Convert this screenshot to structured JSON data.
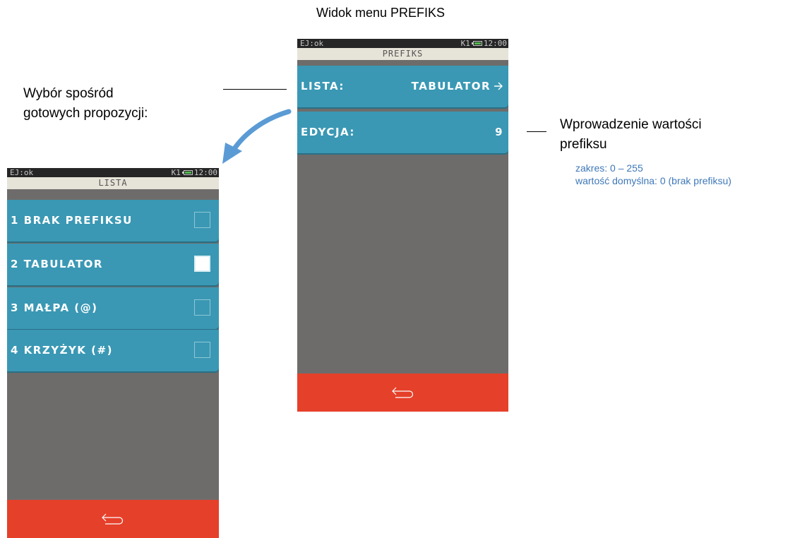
{
  "captions": {
    "title": "Widok menu PREFIKS",
    "left_line1": "Wybór spośród",
    "left_line2": "gotowych propozycji:",
    "right_line1": "Wprowadzenie wartości",
    "right_line2": "prefiksu",
    "right_sub1": "zakres: 0 – 255",
    "right_sub2": "wartość domyślna: 0 (brak prefiksu)"
  },
  "prefiks_screen": {
    "status_left": "EJ:ok",
    "status_k": "K1",
    "status_time": "12:00",
    "title": "PREFIKS",
    "items": [
      {
        "label": "LISTA:",
        "value": "TABULATOR",
        "icon": "arrow-right-icon"
      },
      {
        "label": "EDYCJA:",
        "value": "9"
      }
    ],
    "back_icon": "return-arrow-icon"
  },
  "lista_screen": {
    "status_left": "EJ:ok",
    "status_k": "K1",
    "status_time": "12:00",
    "title": "LISTA",
    "items": [
      {
        "label": "1 BRAK PREFIKSU",
        "checked": false
      },
      {
        "label": "2 TABULATOR",
        "checked": true
      },
      {
        "label": "3 MAŁPA  (@)",
        "checked": false
      },
      {
        "label": "4 KRZYŻYK  (#)",
        "checked": false
      }
    ],
    "back_icon": "return-arrow-icon"
  },
  "colors": {
    "item_bg": "#3a98b4",
    "back_bar": "#e5402a",
    "screen_bg": "#6e6c6b",
    "annotation_blue": "#3f78b8",
    "curved_arrow": "#5b9bd5"
  }
}
